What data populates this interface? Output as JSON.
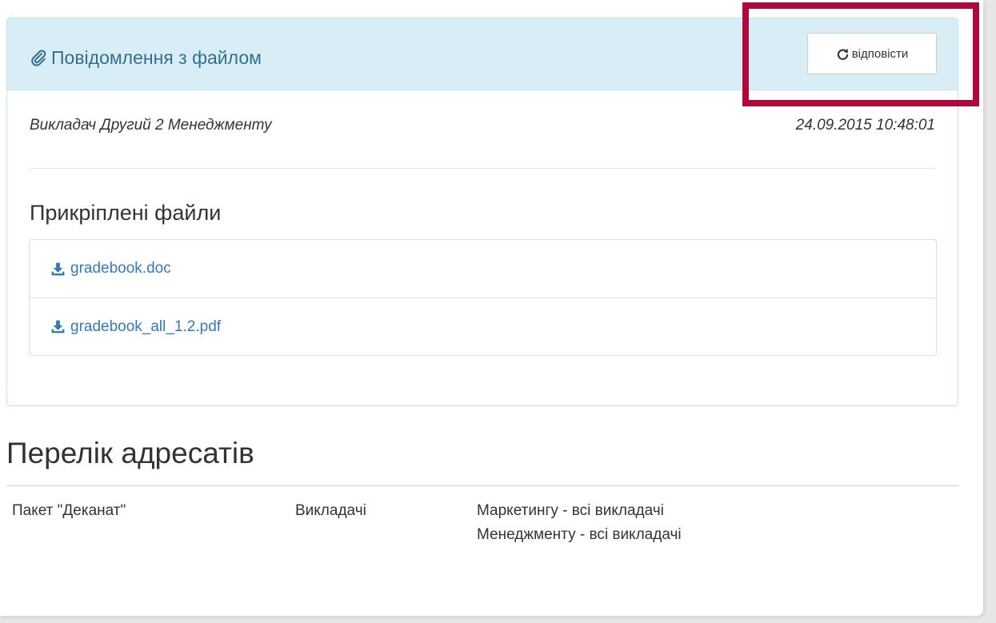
{
  "message_panel": {
    "title": "Повідомлення з файлом",
    "title_icon": "paperclip-icon",
    "reply_button_label": "відповісти",
    "reply_icon": "refresh-icon",
    "author": "Викладач Другий 2 Менеджменту",
    "timestamp": "24.09.2015 10:48:01",
    "attachments_heading": "Прикріплені файли",
    "attachments": [
      {
        "name": "gradebook.doc",
        "icon": "download-icon"
      },
      {
        "name": "gradebook_all_1.2.pdf",
        "icon": "download-icon"
      }
    ]
  },
  "recipients": {
    "heading": "Перелік адресатів",
    "rows": [
      {
        "package": "Пакет \"Деканат\"",
        "group": "Викладачі",
        "details": [
          "Маркетингу - всі викладачі",
          "Менеджменту - всі викладачі"
        ]
      }
    ]
  },
  "colors": {
    "panel_heading_bg": "#d9edf7",
    "panel_border": "#bce8f1",
    "panel_title": "#31708f",
    "link": "#337ab7",
    "highlight_frame": "#b0073c"
  }
}
